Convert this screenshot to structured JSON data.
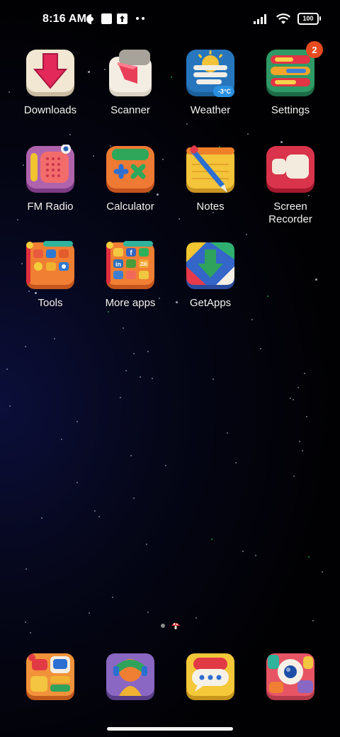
{
  "status_bar": {
    "time": "8:16 AM",
    "battery": "100",
    "icons": [
      "gallery-icon",
      "square-icon",
      "upload-icon",
      "more-dots-icon",
      "signal-icon",
      "wifi-icon",
      "battery-icon"
    ]
  },
  "apps": [
    {
      "label": "Downloads",
      "icon": "downloads-icon"
    },
    {
      "label": "Scanner",
      "icon": "scanner-icon"
    },
    {
      "label": "Weather",
      "icon": "weather-icon",
      "temp": "-3°C"
    },
    {
      "label": "Settings",
      "icon": "settings-icon",
      "badge": "2"
    },
    {
      "label": "FM Radio",
      "icon": "fm-radio-icon"
    },
    {
      "label": "Calculator",
      "icon": "calculator-icon"
    },
    {
      "label": "Notes",
      "icon": "notes-icon"
    },
    {
      "label": "Screen\nRecorder",
      "icon": "screen-recorder-icon"
    },
    {
      "label": "Tools",
      "icon": "tools-folder-icon"
    },
    {
      "label": "More apps",
      "icon": "more-apps-folder-icon"
    },
    {
      "label": "GetApps",
      "icon": "getapps-icon"
    }
  ],
  "folder_glyphs": {
    "more_apps": [
      "f",
      "in",
      "Zili"
    ]
  },
  "dock": [
    {
      "icon": "phone-icon"
    },
    {
      "icon": "contacts-icon"
    },
    {
      "icon": "messages-icon"
    },
    {
      "icon": "camera-icon"
    }
  ]
}
